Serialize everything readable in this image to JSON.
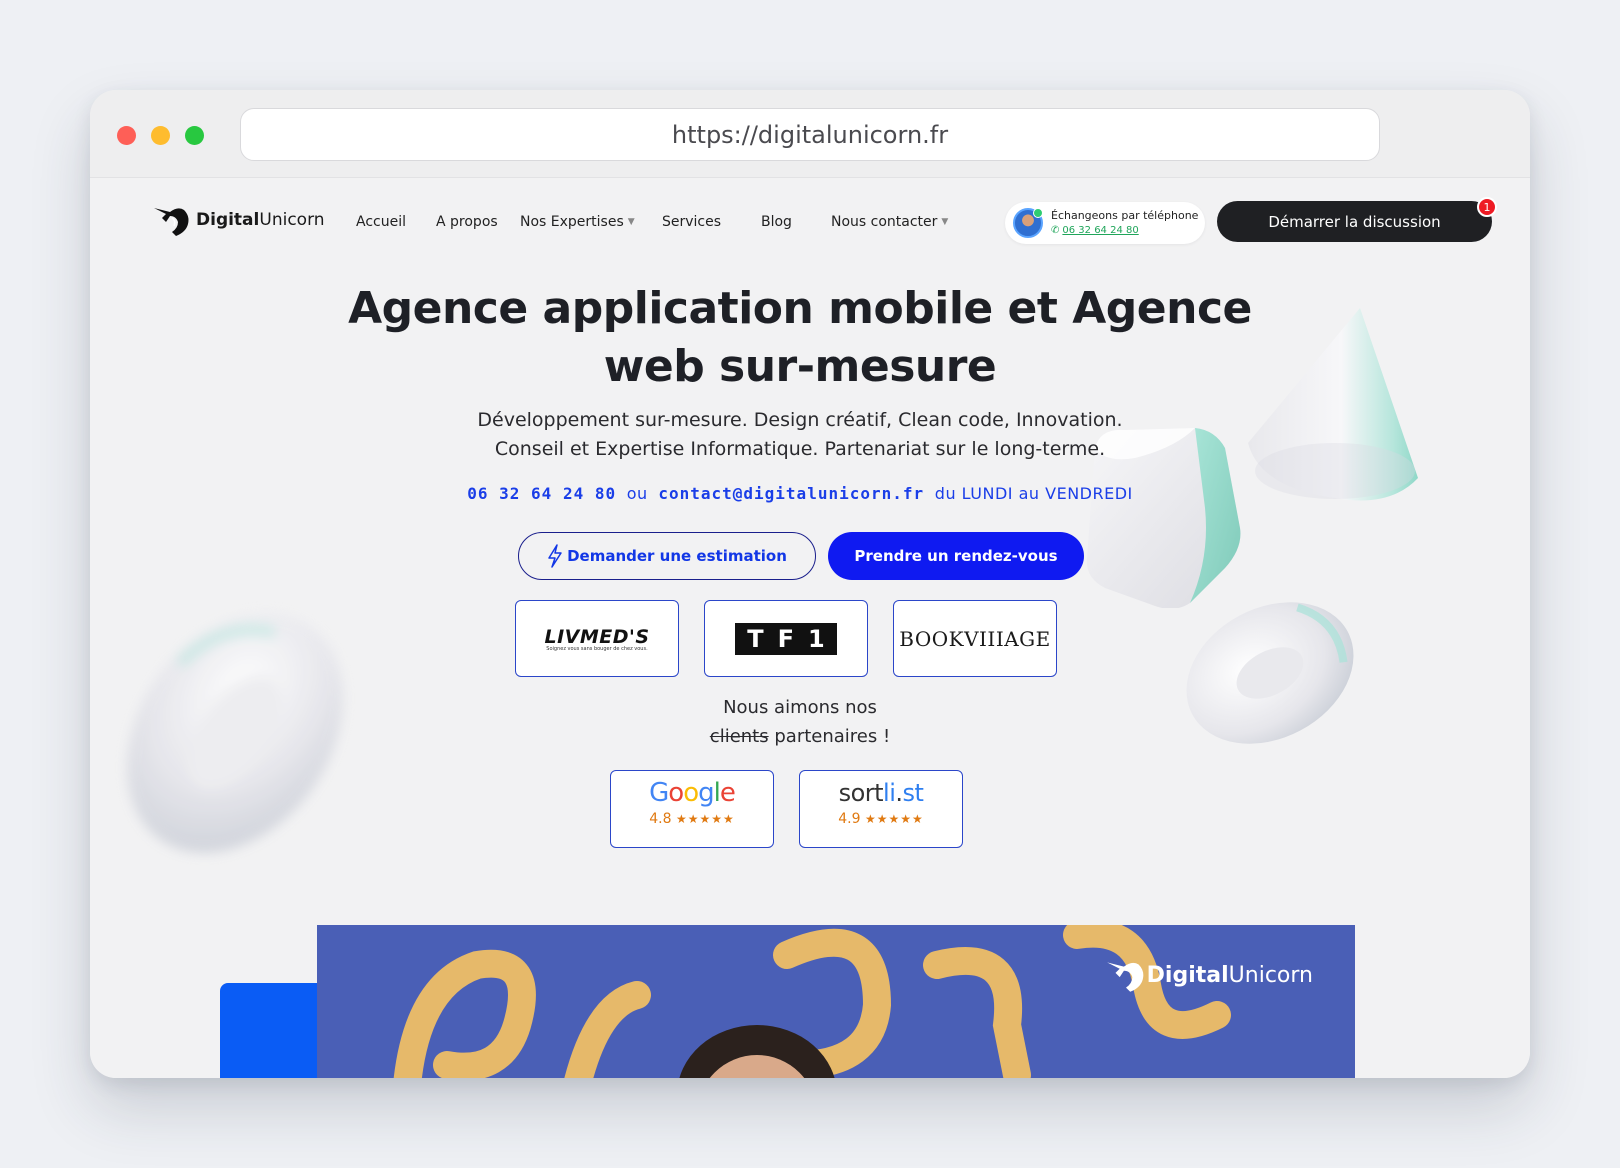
{
  "browser": {
    "url": "https://digitalunicorn.fr"
  },
  "nav": {
    "logo_bold": "Digital",
    "logo_light": "Unicorn",
    "items": [
      {
        "label": "Accueil",
        "dropdown": false
      },
      {
        "label": "A propos",
        "dropdown": false
      },
      {
        "label": "Nos Expertises",
        "dropdown": true
      },
      {
        "label": "Services",
        "dropdown": false
      },
      {
        "label": "Blog",
        "dropdown": false
      },
      {
        "label": "Nous contacter",
        "dropdown": true
      }
    ],
    "phone_pill": {
      "title": "Échangeons par téléphone",
      "phone": "06 32 64 24 80"
    },
    "cta_label": "Démarrer la discussion",
    "notification_count": "1"
  },
  "hero": {
    "title_line1": "Agence application mobile et Agence",
    "title_line2": "web sur-mesure",
    "subtitle_line1": "Développement sur-mesure. Design créatif, Clean code, Innovation.",
    "subtitle_line2": "Conseil et Expertise Informatique. Partenariat sur le long-terme.",
    "contact": {
      "phone": "06 32 64 24 80",
      "or": "ou",
      "email": "contact@digitalunicorn.fr",
      "days": "du LUNDI au VENDREDI"
    },
    "btn_estimate": "Demander une estimation",
    "btn_meeting": "Prendre un rendez-vous"
  },
  "clients": {
    "livmeds": "LIVMED'S",
    "livmeds_tagline": "Soignez vous sans bouger de chez vous.",
    "tf1": [
      "T",
      "F",
      "1"
    ],
    "bookvillage": "BOOKVIIIAGE"
  },
  "love": {
    "line1": "Nous aimons nos",
    "struck": "clients",
    "rest": "partenaires !"
  },
  "reviews": [
    {
      "platform": "Google",
      "score": "4.8",
      "stars": "★★★★★"
    },
    {
      "platform": "sortlist",
      "score": "4.9",
      "stars": "★★★★★"
    }
  ],
  "video": {
    "logo_bold": "Digital",
    "logo_light": "Unicorn"
  },
  "colors": {
    "accent_blue": "#0f1af1",
    "contact_blue": "#1a3ee8",
    "dark_button": "#1f2023",
    "notification_red": "#ee1b24",
    "rating_orange": "#e07a12"
  },
  "icons": {
    "logo": "unicorn-head-icon",
    "estimate": "lightning-icon",
    "phone": "phone-icon",
    "caret": "chevron-down-icon"
  }
}
